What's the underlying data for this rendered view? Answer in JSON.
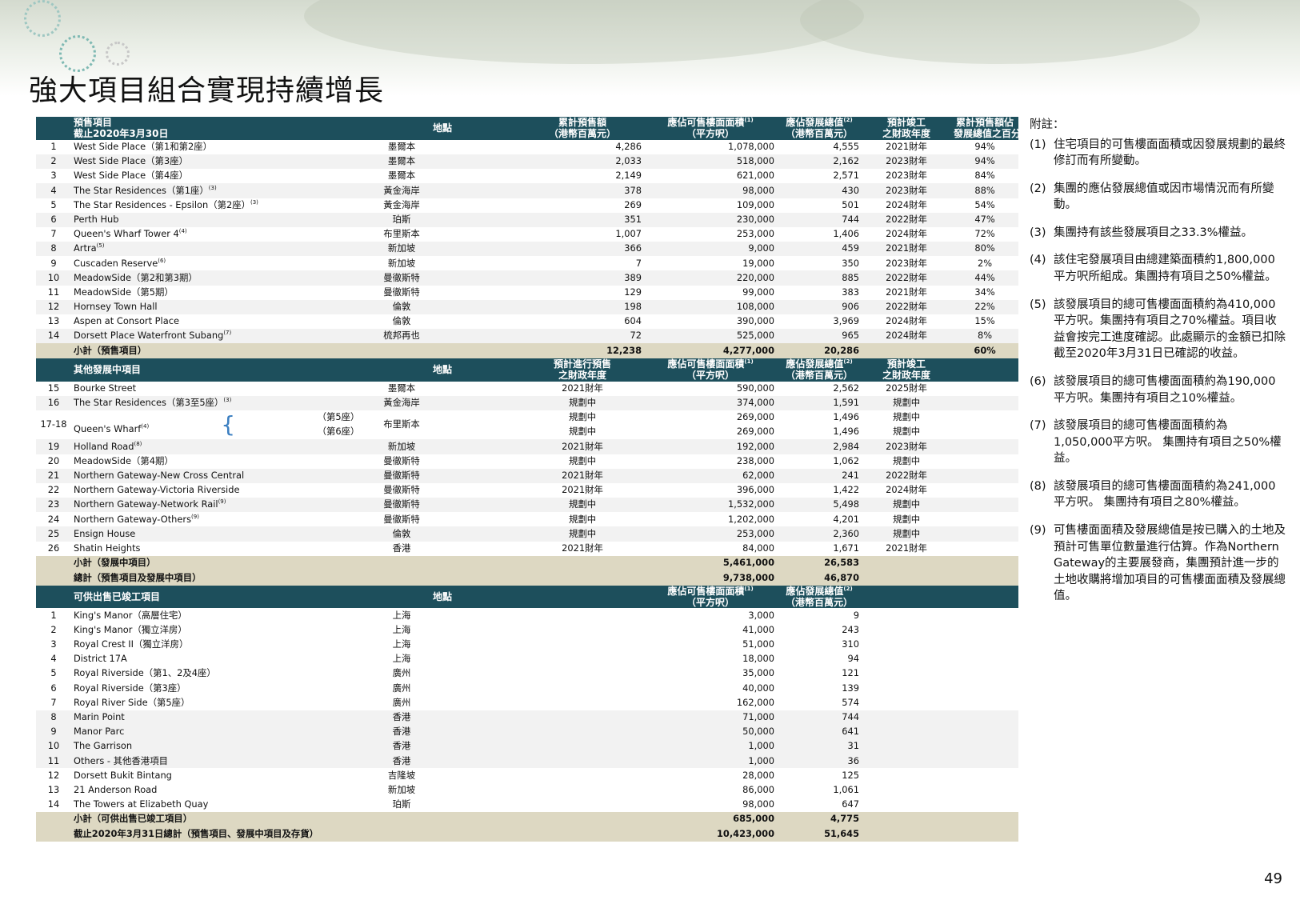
{
  "title": "強大項目組合實現持續增長",
  "page_number": "49",
  "section1": {
    "h_col1_line1": "預售項目",
    "h_col1_line2": "截止2020年3月30日",
    "h_location": "地點",
    "h_presale_line1": "累計預售額",
    "h_presale_line2": "（港幣百萬元）",
    "h_gfa_line1": "應佔可售樓面面積",
    "h_gfa_sup": "(1)",
    "h_gfa_line2": "（平方呎）",
    "h_gdv_line1": "應佔發展總值",
    "h_gdv_sup": "(2)",
    "h_gdv_line2": "（港幣百萬元）",
    "h_completion_line1": "預計竣工",
    "h_completion_line2": "之財政年度",
    "h_pct_line1": "累計預售額佔",
    "h_pct_line2": "發展總值之百分比",
    "rows": [
      {
        "no": "1",
        "name": "West Side Place（第1和第2座）",
        "sup": "",
        "loc": "墨爾本",
        "presale": "4,286",
        "gfa": "1,078,000",
        "gdv": "4,555",
        "year": "2021財年",
        "pct": "94%"
      },
      {
        "no": "2",
        "name": "West Side Place（第3座）",
        "sup": "",
        "loc": "墨爾本",
        "presale": "2,033",
        "gfa": "518,000",
        "gdv": "2,162",
        "year": "2023財年",
        "pct": "94%"
      },
      {
        "no": "3",
        "name": "West Side Place（第4座）",
        "sup": "",
        "loc": "墨爾本",
        "presale": "2,149",
        "gfa": "621,000",
        "gdv": "2,571",
        "year": "2023財年",
        "pct": "84%"
      },
      {
        "no": "4",
        "name": "The Star Residences（第1座）",
        "sup": "(3)",
        "loc": "黃金海岸",
        "presale": "378",
        "gfa": "98,000",
        "gdv": "430",
        "year": "2023財年",
        "pct": "88%"
      },
      {
        "no": "5",
        "name": "The Star Residences - Epsilon（第2座）",
        "sup": "(3)",
        "loc": "黃金海岸",
        "presale": "269",
        "gfa": "109,000",
        "gdv": "501",
        "year": "2024財年",
        "pct": "54%"
      },
      {
        "no": "6",
        "name": "Perth Hub",
        "sup": "",
        "loc": "珀斯",
        "presale": "351",
        "gfa": "230,000",
        "gdv": "744",
        "year": "2022財年",
        "pct": "47%"
      },
      {
        "no": "7",
        "name": "Queen's Wharf Tower 4",
        "sup": "(4)",
        "loc": "布里斯本",
        "presale": "1,007",
        "gfa": "253,000",
        "gdv": "1,406",
        "year": "2024財年",
        "pct": "72%"
      },
      {
        "no": "8",
        "name": "Artra",
        "sup": "(5)",
        "loc": "新加坡",
        "presale": "366",
        "gfa": "9,000",
        "gdv": "459",
        "year": "2021財年",
        "pct": "80%"
      },
      {
        "no": "9",
        "name": "Cuscaden Reserve",
        "sup": "(6)",
        "loc": "新加坡",
        "presale": "7",
        "gfa": "19,000",
        "gdv": "350",
        "year": "2023財年",
        "pct": "2%"
      },
      {
        "no": "10",
        "name": "MeadowSide（第2和第3期）",
        "sup": "",
        "loc": "曼徹斯特",
        "presale": "389",
        "gfa": "220,000",
        "gdv": "885",
        "year": "2022財年",
        "pct": "44%"
      },
      {
        "no": "11",
        "name": "MeadowSide（第5期）",
        "sup": "",
        "loc": "曼徹斯特",
        "presale": "129",
        "gfa": "99,000",
        "gdv": "383",
        "year": "2021財年",
        "pct": "34%"
      },
      {
        "no": "12",
        "name": "Hornsey Town Hall",
        "sup": "",
        "loc": "倫敦",
        "presale": "198",
        "gfa": "108,000",
        "gdv": "906",
        "year": "2022財年",
        "pct": "22%"
      },
      {
        "no": "13",
        "name": "Aspen at Consort Place",
        "sup": "",
        "loc": "倫敦",
        "presale": "604",
        "gfa": "390,000",
        "gdv": "3,969",
        "year": "2024財年",
        "pct": "15%"
      },
      {
        "no": "14",
        "name": "Dorsett Place Waterfront Subang",
        "sup": "(7)",
        "loc": "梳邦再也",
        "presale": "72",
        "gfa": "525,000",
        "gdv": "965",
        "year": "2024財年",
        "pct": "8%"
      }
    ],
    "subtotal": {
      "label": "小計（預售項目）",
      "presale": "12,238",
      "gfa": "4,277,000",
      "gdv": "20,286",
      "pct": "60%"
    }
  },
  "section2": {
    "h_col1": "其他發展中項目",
    "h_location": "地點",
    "h_presale_line1": "預計進行預售",
    "h_presale_line2": "之財政年度",
    "h_gfa_line1": "應佔可售樓面面積",
    "h_gfa_sup": "(1)",
    "h_gfa_line2": "（平方呎）",
    "h_gdv_line1": "應佔發展總值",
    "h_gdv_sup": "(2)",
    "h_gdv_line2": "（港幣百萬元）",
    "h_completion_line1": "預計竣工",
    "h_completion_line2": "之財政年度",
    "rows_a": [
      {
        "no": "15",
        "name": "Bourke Street",
        "sup": "",
        "loc": "墨爾本",
        "presale": "2021財年",
        "gfa": "590,000",
        "gdv": "2,562",
        "year": "2025財年"
      },
      {
        "no": "16",
        "name": "The Star Residences（第3至5座）",
        "sup": "(3)",
        "loc": "黃金海岸",
        "presale": "規劃中",
        "gfa": "374,000",
        "gdv": "1,591",
        "year": "規劃中"
      }
    ],
    "qw": {
      "no": "17-18",
      "name": "Queen's Wharf",
      "sup": "(4)",
      "tower5": "（第5座）",
      "tower6": "（第6座）",
      "loc": "布里斯本",
      "presale5": "規劃中",
      "gfa5": "269,000",
      "gdv5": "1,496",
      "year5": "規劃中",
      "presale6": "規劃中",
      "gfa6": "269,000",
      "gdv6": "1,496",
      "year6": "規劃中"
    },
    "rows_b": [
      {
        "no": "19",
        "name": "Holland Road",
        "sup": "(8)",
        "loc": "新加坡",
        "presale": "2021財年",
        "gfa": "192,000",
        "gdv": "2,984",
        "year": "2023財年"
      },
      {
        "no": "20",
        "name": "MeadowSide（第4期）",
        "sup": "",
        "loc": "曼徹斯特",
        "presale": "規劃中",
        "gfa": "238,000",
        "gdv": "1,062",
        "year": "規劃中"
      },
      {
        "no": "21",
        "name": "Northern Gateway-New Cross Central",
        "sup": "",
        "loc": "曼徹斯特",
        "presale": "2021財年",
        "gfa": "62,000",
        "gdv": "241",
        "year": "2022財年"
      },
      {
        "no": "22",
        "name": "Northern Gateway-Victoria Riverside",
        "sup": "",
        "loc": "曼徹斯特",
        "presale": "2021財年",
        "gfa": "396,000",
        "gdv": "1,422",
        "year": "2024財年"
      },
      {
        "no": "23",
        "name": "Northern Gateway-Network Rail",
        "sup": "(9)",
        "loc": "曼徹斯特",
        "presale": "規劃中",
        "gfa": "1,532,000",
        "gdv": "5,498",
        "year": "規劃中"
      },
      {
        "no": "24",
        "name": "Northern Gateway-Others",
        "sup": "(9)",
        "loc": "曼徹斯特",
        "presale": "規劃中",
        "gfa": "1,202,000",
        "gdv": "4,201",
        "year": "規劃中"
      },
      {
        "no": "25",
        "name": "Ensign House",
        "sup": "",
        "loc": "倫敦",
        "presale": "規劃中",
        "gfa": "253,000",
        "gdv": "2,360",
        "year": "規劃中"
      },
      {
        "no": "26",
        "name": "Shatin Heights",
        "sup": "",
        "loc": "香港",
        "presale": "2021財年",
        "gfa": "84,000",
        "gdv": "1,671",
        "year": "2021財年"
      }
    ],
    "subtotal": {
      "label": "小計（發展中項目）",
      "gfa": "5,461,000",
      "gdv": "26,583"
    },
    "total": {
      "label": "總計（預售項目及發展中項目）",
      "gfa": "9,738,000",
      "gdv": "46,870"
    }
  },
  "section3": {
    "h_col1": "可供出售已竣工項目",
    "h_location": "地點",
    "h_gfa_line1": "應佔可售樓面面積",
    "h_gfa_sup": "(1)",
    "h_gfa_line2": "（平方呎）",
    "h_gdv_line1": "應佔發展總值",
    "h_gdv_sup": "(2)",
    "h_gdv_line2": "（港幣百萬元）",
    "rows": [
      {
        "no": "1",
        "name": "King's Manor（高層住宅）",
        "loc": "上海",
        "gfa": "3,000",
        "gdv": "9"
      },
      {
        "no": "2",
        "name": "King's Manor（獨立洋房）",
        "loc": "上海",
        "gfa": "41,000",
        "gdv": "243"
      },
      {
        "no": "3",
        "name": "Royal Crest II（獨立洋房）",
        "loc": "上海",
        "gfa": "51,000",
        "gdv": "310"
      },
      {
        "no": "4",
        "name": "District 17A",
        "loc": "上海",
        "gfa": "18,000",
        "gdv": "94"
      },
      {
        "no": "5",
        "name": "Royal Riverside（第1、2及4座）",
        "loc": "廣州",
        "gfa": "35,000",
        "gdv": "121"
      },
      {
        "no": "6",
        "name": "Royal Riverside（第3座）",
        "loc": "廣州",
        "gfa": "40,000",
        "gdv": "139"
      },
      {
        "no": "7",
        "name": "Royal River Side（第5座）",
        "loc": "廣州",
        "gfa": "162,000",
        "gdv": "574"
      },
      {
        "no": "8",
        "name": "Marin Point",
        "loc": "香港",
        "gfa": "71,000",
        "gdv": "744"
      },
      {
        "no": "9",
        "name": "Manor Parc",
        "loc": "香港",
        "gfa": "50,000",
        "gdv": "641"
      },
      {
        "no": "10",
        "name": "The Garrison",
        "loc": "香港",
        "gfa": "1,000",
        "gdv": "31"
      },
      {
        "no": "11",
        "name": "Others - 其他香港項目",
        "loc": "香港",
        "gfa": "1,000",
        "gdv": "36"
      },
      {
        "no": "12",
        "name": "Dorsett Bukit Bintang",
        "loc": "吉隆坡",
        "gfa": "28,000",
        "gdv": "125"
      },
      {
        "no": "13",
        "name": "21 Anderson Road",
        "loc": "新加坡",
        "gfa": "86,000",
        "gdv": "1,061"
      },
      {
        "no": "14",
        "name": "The Towers at Elizabeth Quay",
        "loc": "珀斯",
        "gfa": "98,000",
        "gdv": "647"
      }
    ],
    "subtotal": {
      "label": "小計（可供出售已竣工項目）",
      "gfa": "685,000",
      "gdv": "4,775"
    },
    "total": {
      "label": "截止2020年3月31日總計（預售項目、發展中項目及存貨）",
      "gfa": "10,423,000",
      "gdv": "51,645"
    }
  },
  "notes": {
    "heading": "附註：",
    "items": [
      {
        "num": "(1)",
        "text": "住宅項目的可售樓面面積或因發展規劃的最終修訂而有所變動。"
      },
      {
        "num": "(2)",
        "text": "集團的應佔發展總值或因市場情況而有所變動。"
      },
      {
        "num": "(3)",
        "text": "集團持有該些發展項目之33.3%權益。"
      },
      {
        "num": "(4)",
        "text": "該住宅發展項目由總建築面積約1,800,000平方呎所組成。集團持有項目之50%權益。"
      },
      {
        "num": "(5)",
        "text": "該發展項目的總可售樓面面積約為410,000平方呎。集團持有項目之70%權益。項目收益會按完工進度確認。此處顯示的金額已扣除截至2020年3月31日已確認的收益。"
      },
      {
        "num": "(6)",
        "text": "該發展項目的總可售樓面面積約為190,000平方呎。集團持有項目之10%權益。"
      },
      {
        "num": "(7)",
        "text": "該發展項目的總可售樓面面積約為1,050,000平方呎。 集團持有項目之50%權益。"
      },
      {
        "num": "(8)",
        "text": "該發展項目的總可售樓面面積約為241,000平方呎。 集團持有項目之80%權益。"
      },
      {
        "num": "(9)",
        "text": "可售樓面面積及發展總值是按已購入的土地及預計可售單位數量進行估算。作為Northern Gateway的主要展發商，集團預計進一步的土地收購將增加項目的可售樓面面積及發展總值。"
      }
    ]
  }
}
